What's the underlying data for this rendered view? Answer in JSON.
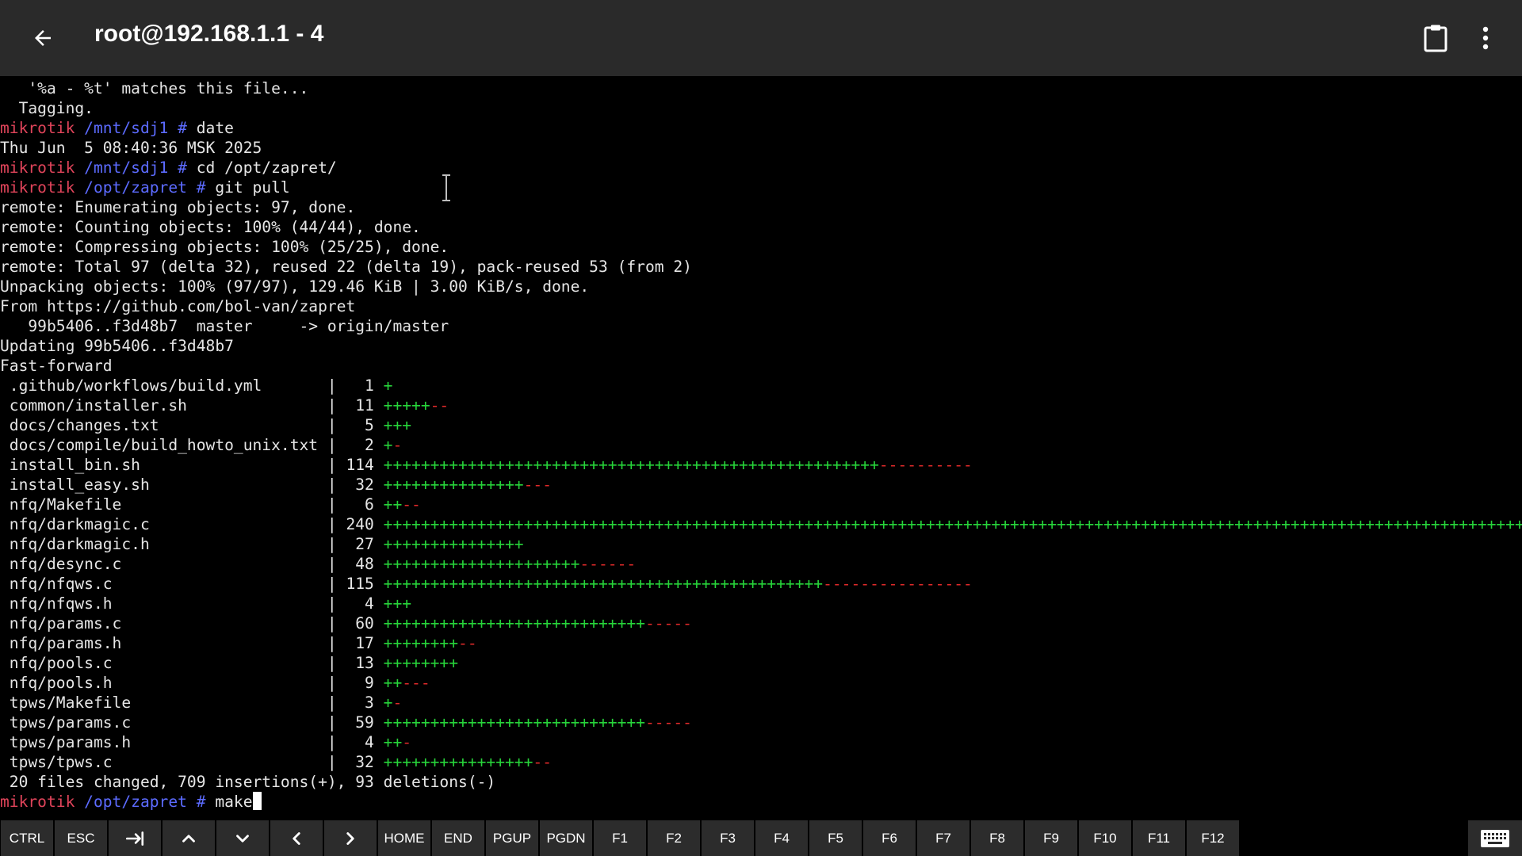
{
  "titlebar": {
    "title": "root@192.168.1.1 - 4",
    "back_icon": "arrow-back-icon",
    "clipboard_icon": "clipboard-icon",
    "menu_icon": "more-vert-icon",
    "background": "#2a2a2a"
  },
  "terminal": {
    "colors": {
      "default": "#e6e6e6",
      "prompt_user": "#e0445a",
      "prompt_path": "#5c6bff",
      "diff_plus": "#27d43a",
      "diff_minus": "#e02a2a"
    },
    "lines": [
      {
        "segs": [
          {
            "t": "   '%a - %t' matches this file..."
          }
        ]
      },
      {
        "segs": [
          {
            "t": "  Tagging."
          }
        ]
      },
      {
        "segs": [
          {
            "t": "mikrotik ",
            "c": "red"
          },
          {
            "t": "/mnt/sdj1 # ",
            "c": "blue"
          },
          {
            "t": "date"
          }
        ]
      },
      {
        "segs": [
          {
            "t": "Thu Jun  5 08:40:36 MSK 2025"
          }
        ]
      },
      {
        "segs": [
          {
            "t": "mikrotik ",
            "c": "red"
          },
          {
            "t": "/mnt/sdj1 # ",
            "c": "blue"
          },
          {
            "t": "cd /opt/zapret/"
          }
        ]
      },
      {
        "segs": [
          {
            "t": "mikrotik ",
            "c": "red"
          },
          {
            "t": "/opt/zapret # ",
            "c": "blue"
          },
          {
            "t": "git pull"
          }
        ]
      },
      {
        "segs": [
          {
            "t": "remote: Enumerating objects: 97, done."
          }
        ]
      },
      {
        "segs": [
          {
            "t": "remote: Counting objects: 100% (44/44), done."
          }
        ]
      },
      {
        "segs": [
          {
            "t": "remote: Compressing objects: 100% (25/25), done."
          }
        ]
      },
      {
        "segs": [
          {
            "t": "remote: Total 97 (delta 32), reused 22 (delta 19), pack-reused 53 (from 2)"
          }
        ]
      },
      {
        "segs": [
          {
            "t": "Unpacking objects: 100% (97/97), 129.46 KiB | 3.00 KiB/s, done."
          }
        ]
      },
      {
        "segs": [
          {
            "t": "From https://github.com/bol-van/zapret"
          }
        ]
      },
      {
        "segs": [
          {
            "t": "   99b5406..f3d48b7  master     -> origin/master"
          }
        ]
      },
      {
        "segs": [
          {
            "t": "Updating 99b5406..f3d48b7"
          }
        ]
      },
      {
        "segs": [
          {
            "t": "Fast-forward"
          }
        ]
      },
      {
        "segs": [
          {
            "t": " .github/workflows/build.yml       |   1 "
          },
          {
            "t": "+",
            "c": "green"
          }
        ]
      },
      {
        "segs": [
          {
            "t": " common/installer.sh               |  11 "
          },
          {
            "t": "+++++",
            "c": "green"
          },
          {
            "t": "--",
            "c": "minus"
          }
        ]
      },
      {
        "segs": [
          {
            "t": " docs/changes.txt                  |   5 "
          },
          {
            "t": "+++",
            "c": "green"
          }
        ]
      },
      {
        "segs": [
          {
            "t": " docs/compile/build_howto_unix.txt |   2 "
          },
          {
            "t": "+",
            "c": "green"
          },
          {
            "t": "-",
            "c": "minus"
          }
        ]
      },
      {
        "segs": [
          {
            "t": " install_bin.sh                    | 114 "
          },
          {
            "t": "+++++++++++++++++++++++++++++++++++++++++++++++++++++",
            "c": "green"
          },
          {
            "t": "----------",
            "c": "minus"
          }
        ]
      },
      {
        "segs": [
          {
            "t": " install_easy.sh                   |  32 "
          },
          {
            "t": "+++++++++++++++",
            "c": "green"
          },
          {
            "t": "---",
            "c": "minus"
          }
        ]
      },
      {
        "segs": [
          {
            "t": " nfq/Makefile                      |   6 "
          },
          {
            "t": "++",
            "c": "green"
          },
          {
            "t": "--",
            "c": "minus"
          }
        ]
      },
      {
        "segs": [
          {
            "t": " nfq/darkmagic.c                   | 240 "
          },
          {
            "t": "+++++++++++++++++++++++++++++++++++++++++++++++++++++++++++++++++++++++++++++++++++++++++++++++++++++++++++++++++++++++++++++++++++++++++",
            "c": "green"
          }
        ]
      },
      {
        "segs": [
          {
            "t": " nfq/darkmagic.h                   |  27 "
          },
          {
            "t": "+++++++++++++++",
            "c": "green"
          }
        ]
      },
      {
        "segs": [
          {
            "t": " nfq/desync.c                      |  48 "
          },
          {
            "t": "+++++++++++++++++++++",
            "c": "green"
          },
          {
            "t": "------",
            "c": "minus"
          }
        ]
      },
      {
        "segs": [
          {
            "t": " nfq/nfqws.c                       | 115 "
          },
          {
            "t": "+++++++++++++++++++++++++++++++++++++++++++++++",
            "c": "green"
          },
          {
            "t": "----------------",
            "c": "minus"
          }
        ]
      },
      {
        "segs": [
          {
            "t": " nfq/nfqws.h                       |   4 "
          },
          {
            "t": "+++",
            "c": "green"
          }
        ]
      },
      {
        "segs": [
          {
            "t": " nfq/params.c                      |  60 "
          },
          {
            "t": "++++++++++++++++++++++++++++",
            "c": "green"
          },
          {
            "t": "-----",
            "c": "minus"
          }
        ]
      },
      {
        "segs": [
          {
            "t": " nfq/params.h                      |  17 "
          },
          {
            "t": "++++++++",
            "c": "green"
          },
          {
            "t": "--",
            "c": "minus"
          }
        ]
      },
      {
        "segs": [
          {
            "t": " nfq/pools.c                       |  13 "
          },
          {
            "t": "++++++++",
            "c": "green"
          }
        ]
      },
      {
        "segs": [
          {
            "t": " nfq/pools.h                       |   9 "
          },
          {
            "t": "++",
            "c": "green"
          },
          {
            "t": "---",
            "c": "minus"
          }
        ]
      },
      {
        "segs": [
          {
            "t": " tpws/Makefile                     |   3 "
          },
          {
            "t": "+",
            "c": "green"
          },
          {
            "t": "-",
            "c": "minus"
          }
        ]
      },
      {
        "segs": [
          {
            "t": " tpws/params.c                     |  59 "
          },
          {
            "t": "++++++++++++++++++++++++++++",
            "c": "green"
          },
          {
            "t": "-----",
            "c": "minus"
          }
        ]
      },
      {
        "segs": [
          {
            "t": " tpws/params.h                     |   4 "
          },
          {
            "t": "++",
            "c": "green"
          },
          {
            "t": "-",
            "c": "minus"
          }
        ]
      },
      {
        "segs": [
          {
            "t": " tpws/tpws.c                       |  32 "
          },
          {
            "t": "++++++++++++++++",
            "c": "green"
          },
          {
            "t": "--",
            "c": "minus"
          }
        ]
      },
      {
        "segs": [
          {
            "t": " 20 files changed, 709 insertions(+), 93 deletions(-)"
          }
        ]
      },
      {
        "segs": [
          {
            "t": "mikrotik ",
            "c": "red"
          },
          {
            "t": "/opt/zapret # ",
            "c": "blue"
          },
          {
            "t": "make"
          }
        ],
        "cursor": true
      }
    ]
  },
  "extra_keys": {
    "keys": [
      {
        "label": "CTRL",
        "name": "ctrl"
      },
      {
        "label": "ESC",
        "name": "esc"
      },
      {
        "label": "",
        "name": "tab",
        "icon": "tab-icon"
      },
      {
        "label": "",
        "name": "arrow-up",
        "icon": "chevron-up-icon"
      },
      {
        "label": "",
        "name": "arrow-down",
        "icon": "chevron-down-icon"
      },
      {
        "label": "",
        "name": "arrow-left",
        "icon": "chevron-left-icon"
      },
      {
        "label": "",
        "name": "arrow-right",
        "icon": "chevron-right-icon"
      },
      {
        "label": "HOME",
        "name": "home"
      },
      {
        "label": "END",
        "name": "end"
      },
      {
        "label": "PGUP",
        "name": "pgup"
      },
      {
        "label": "PGDN",
        "name": "pgdn"
      },
      {
        "label": "F1",
        "name": "f1"
      },
      {
        "label": "F2",
        "name": "f2"
      },
      {
        "label": "F3",
        "name": "f3"
      },
      {
        "label": "F4",
        "name": "f4"
      },
      {
        "label": "F5",
        "name": "f5"
      },
      {
        "label": "F6",
        "name": "f6"
      },
      {
        "label": "F7",
        "name": "f7"
      },
      {
        "label": "F8",
        "name": "f8"
      },
      {
        "label": "F9",
        "name": "f9"
      },
      {
        "label": "F10",
        "name": "f10"
      },
      {
        "label": "F11",
        "name": "f11"
      },
      {
        "label": "F12",
        "name": "f12"
      }
    ],
    "keyboard_toggle_icon": "keyboard-icon"
  }
}
